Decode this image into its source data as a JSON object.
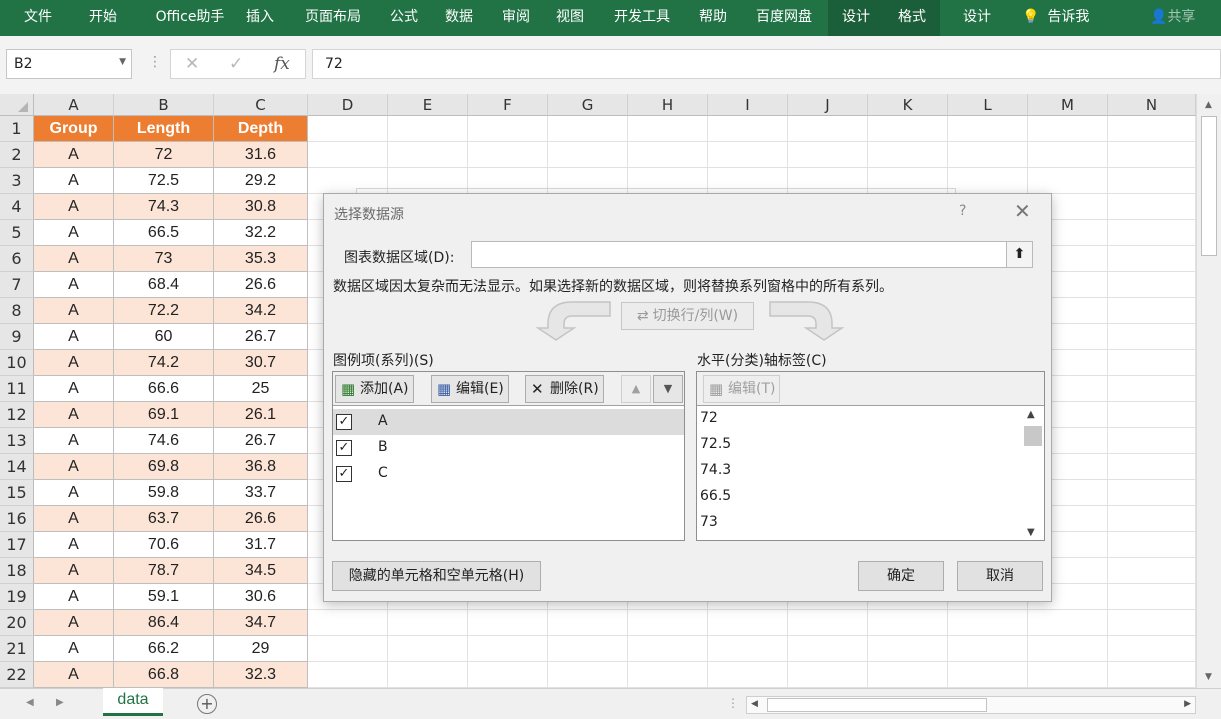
{
  "ribbon": {
    "tabs": [
      "文件",
      "开始",
      "Office助手",
      "插入",
      "页面布局",
      "公式",
      "数据",
      "审阅",
      "视图",
      "开发工具",
      "帮助",
      "百度网盘",
      "设计",
      "格式",
      "设计"
    ],
    "tell_me": "告诉我",
    "share": "共享"
  },
  "formula_bar": {
    "name_box": "B2",
    "cancel_icon": "✕",
    "confirm_icon": "✓",
    "fx_label": "fx",
    "value": "72"
  },
  "sheet": {
    "columns": [
      "A",
      "B",
      "C",
      "D",
      "E",
      "F",
      "G",
      "H",
      "I",
      "J",
      "K",
      "L",
      "M",
      "N"
    ],
    "rows": [
      [
        "Group",
        "Length",
        "Depth"
      ],
      [
        "A",
        "72",
        "31.6"
      ],
      [
        "A",
        "72.5",
        "29.2"
      ],
      [
        "A",
        "74.3",
        "30.8"
      ],
      [
        "A",
        "66.5",
        "32.2"
      ],
      [
        "A",
        "73",
        "35.3"
      ],
      [
        "A",
        "68.4",
        "26.6"
      ],
      [
        "A",
        "72.2",
        "34.2"
      ],
      [
        "A",
        "60",
        "26.7"
      ],
      [
        "A",
        "74.2",
        "30.7"
      ],
      [
        "A",
        "66.6",
        "25"
      ],
      [
        "A",
        "69.1",
        "26.1"
      ],
      [
        "A",
        "74.6",
        "26.7"
      ],
      [
        "A",
        "69.8",
        "36.8"
      ],
      [
        "A",
        "59.8",
        "33.7"
      ],
      [
        "A",
        "63.7",
        "26.6"
      ],
      [
        "A",
        "70.6",
        "31.7"
      ],
      [
        "A",
        "78.7",
        "34.5"
      ],
      [
        "A",
        "59.1",
        "30.6"
      ],
      [
        "A",
        "86.4",
        "34.7"
      ],
      [
        "A",
        "66.2",
        "29"
      ],
      [
        "A",
        "66.8",
        "32.3"
      ]
    ],
    "header_color": "#ed7d31",
    "band_color": "#fce4d6",
    "tab_name": "data"
  },
  "dialog": {
    "title": "选择数据源",
    "help": "?",
    "close": "✕",
    "range_label": "图表数据区域(D):",
    "range_value": "",
    "message": "数据区域因太复杂而无法显示。如果选择新的数据区域，则将替换系列窗格中的所有系列。",
    "switch_label": "切换行/列(W)",
    "series_label": "图例项(系列)(S)",
    "add_label": "添加(A)",
    "edit_label": "编辑(E)",
    "delete_label": "删除(R)",
    "series": [
      "A",
      "B",
      "C"
    ],
    "axis_label": "水平(分类)轴标签(C)",
    "axis_edit_label": "编辑(T)",
    "axis_values": [
      "72",
      "72.5",
      "74.3",
      "66.5",
      "73"
    ],
    "hidden_cells_label": "隐藏的单元格和空单元格(H)",
    "ok_label": "确定",
    "cancel_label": "取消"
  }
}
